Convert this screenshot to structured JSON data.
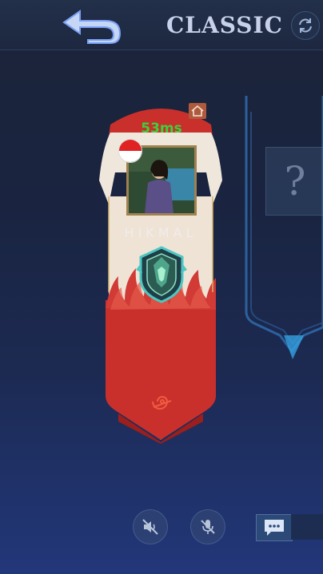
{
  "header": {
    "back_icon": "back-arrow-icon",
    "mode_title": "CLASSIC",
    "refresh_icon": "refresh-icon"
  },
  "player_card": {
    "ping": "53ms",
    "ping_color": "#3bd13b",
    "home_icon": "home-icon",
    "flag_icon": "indonesia-flag-icon",
    "name": "HIKMAL",
    "rank_icon": "rank-emblem-icon",
    "clan_icon": "leaf-village-symbol-icon",
    "banner_color": "#c9302c"
  },
  "empty_slot": {
    "placeholder": "?"
  },
  "bottom_controls": {
    "mute_speaker_icon": "speaker-muted-icon",
    "mute_mic_icon": "mic-muted-icon",
    "chat_icon": "chat-icon"
  }
}
